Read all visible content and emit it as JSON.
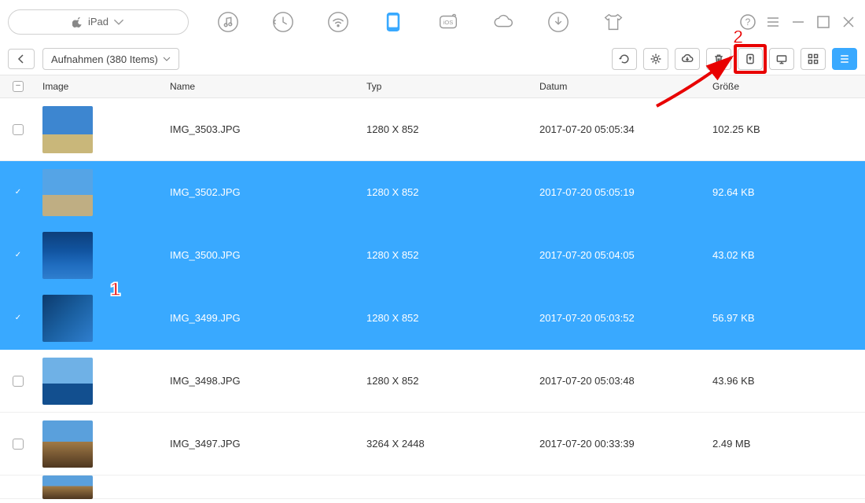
{
  "device": {
    "label": "iPad"
  },
  "breadcrumb": {
    "label": "Aufnahmen (380 Items)"
  },
  "columns": {
    "image": "Image",
    "name": "Name",
    "type": "Typ",
    "date": "Datum",
    "size": "Größe"
  },
  "annotations": {
    "one": "1",
    "two": "2"
  },
  "rows": [
    {
      "selected": false,
      "name": "IMG_3503.JPG",
      "type": "1280 X 852",
      "date": "2017-07-20 05:05:34",
      "size": "102.25 KB",
      "thumb": "linear-gradient(to bottom, #3d86d0 0%, #3d86d0 60%, #c9b77a 60%, #c9b77a 100%)"
    },
    {
      "selected": true,
      "name": "IMG_3502.JPG",
      "type": "1280 X 852",
      "date": "2017-07-20 05:05:19",
      "size": "92.64 KB",
      "thumb": "linear-gradient(to bottom, #55a4e6 0%, #55a4e6 55%, #bfae83 55%, #bfae83 100%)"
    },
    {
      "selected": true,
      "name": "IMG_3500.JPG",
      "type": "1280 X 852",
      "date": "2017-07-20 05:04:05",
      "size": "43.02 KB",
      "thumb": "linear-gradient(to bottom, #0d3f7a 0%, #1154a0 40%, #1f6cbf 70%, #2f7fcf 100%)"
    },
    {
      "selected": true,
      "name": "IMG_3499.JPG",
      "type": "1280 X 852",
      "date": "2017-07-20 05:03:52",
      "size": "56.97 KB",
      "thumb": "linear-gradient(135deg, #0c3a6d 0%, #1a5fa0 50%, #2f7fcf 100%)"
    },
    {
      "selected": false,
      "name": "IMG_3498.JPG",
      "type": "1280 X 852",
      "date": "2017-07-20 05:03:48",
      "size": "43.96 KB",
      "thumb": "linear-gradient(to bottom, #6fb1e6 0%, #6fb1e6 55%, #124f8f 55%, #124f8f 100%)"
    },
    {
      "selected": false,
      "name": "IMG_3497.JPG",
      "type": "3264 X 2448",
      "date": "2017-07-20 00:33:39",
      "size": "2.49 MB",
      "thumb": "linear-gradient(to bottom, #5aa0dc 0%, #5aa0dc 45%, #a07a46 45%, #4e3720 100%)"
    },
    {
      "selected": false,
      "name": "",
      "type": "",
      "date": "",
      "size": "",
      "thumb": "linear-gradient(to bottom, #5aa0dc 0%, #5aa0dc 45%, #a07a46 45%, #4e3720 100%)",
      "partial": true
    }
  ]
}
